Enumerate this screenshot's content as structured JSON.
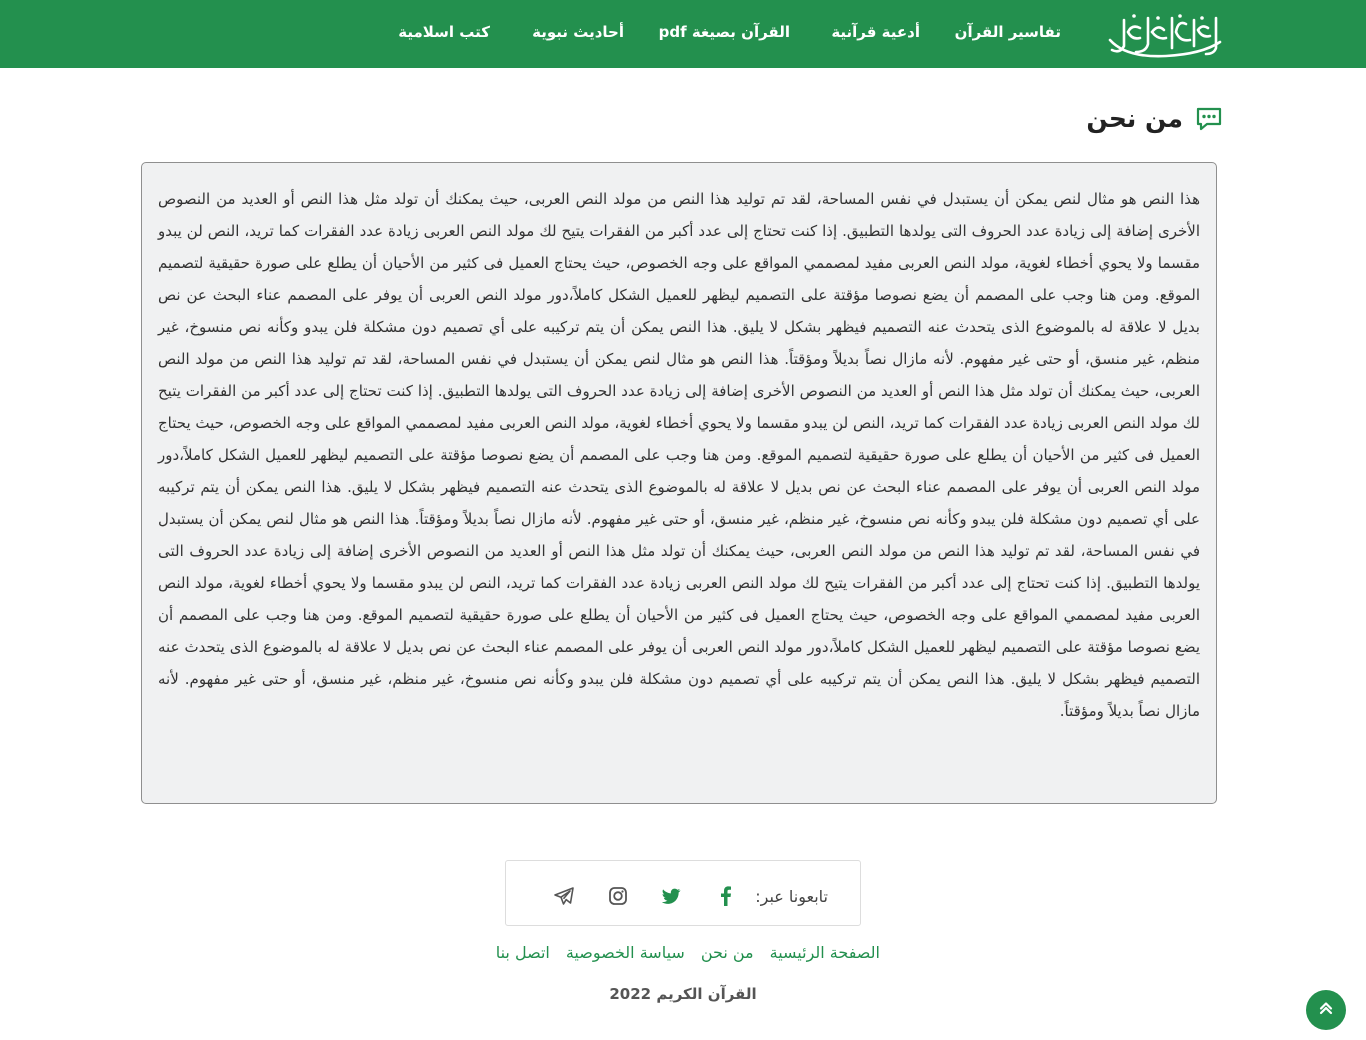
{
  "header": {
    "logo_alt": "القرآن الكريم",
    "nav": [
      {
        "label": "تفاسير القرآن"
      },
      {
        "label": "أدعية قرآنية"
      },
      {
        "label": "القرآن بصيغة pdf"
      },
      {
        "label": "أحاديث نبوية"
      },
      {
        "label": "كتب اسلامية"
      }
    ]
  },
  "page": {
    "title": "من نحن",
    "body": "هذا النص هو مثال لنص يمكن أن يستبدل في نفس المساحة، لقد تم توليد هذا النص من مولد النص العربى، حيث يمكنك أن تولد مثل هذا النص أو العديد من النصوص الأخرى إضافة إلى زيادة عدد الحروف التى يولدها التطبيق. إذا كنت تحتاج إلى عدد أكبر من الفقرات يتيح لك مولد النص العربى زيادة عدد الفقرات كما تريد، النص لن يبدو مقسما ولا يحوي أخطاء لغوية، مولد النص العربى مفيد لمصممي المواقع على وجه الخصوص، حيث يحتاج العميل فى كثير من الأحيان أن يطلع على صورة حقيقية لتصميم الموقع. ومن هنا وجب على المصمم أن يضع نصوصا مؤقتة على التصميم ليظهر للعميل الشكل كاملاً،دور مولد النص العربى أن يوفر على المصمم عناء البحث عن نص بديل لا علاقة له بالموضوع الذى يتحدث عنه التصميم فيظهر بشكل لا يليق. هذا النص يمكن أن يتم تركيبه على أي تصميم دون مشكلة فلن يبدو وكأنه نص منسوخ، غير منظم، غير منسق، أو حتى غير مفهوم. لأنه مازال نصاً بديلاً ومؤقتاً. هذا النص هو مثال لنص يمكن أن يستبدل في نفس المساحة، لقد تم توليد هذا النص من مولد النص العربى، حيث يمكنك أن تولد مثل هذا النص أو العديد من النصوص الأخرى إضافة إلى زيادة عدد الحروف التى يولدها التطبيق. إذا كنت تحتاج إلى عدد أكبر من الفقرات يتيح لك مولد النص العربى زيادة عدد الفقرات كما تريد، النص لن يبدو مقسما ولا يحوي أخطاء لغوية، مولد النص العربى مفيد لمصممي المواقع على وجه الخصوص، حيث يحتاج العميل فى كثير من الأحيان أن يطلع على صورة حقيقية لتصميم الموقع. ومن هنا وجب على المصمم أن يضع نصوصا مؤقتة على التصميم ليظهر للعميل الشكل كاملاً،دور مولد النص العربى أن يوفر على المصمم عناء البحث عن نص بديل لا علاقة له بالموضوع الذى يتحدث عنه التصميم فيظهر بشكل لا يليق. هذا النص يمكن أن يتم تركيبه على أي تصميم دون مشكلة فلن يبدو وكأنه نص منسوخ، غير منظم، غير منسق، أو حتى غير مفهوم. لأنه مازال نصاً بديلاً ومؤقتاً. هذا النص هو مثال لنص يمكن أن يستبدل في نفس المساحة، لقد تم توليد هذا النص من مولد النص العربى، حيث يمكنك أن تولد مثل هذا النص أو العديد من النصوص الأخرى إضافة إلى زيادة عدد الحروف التى يولدها التطبيق. إذا كنت تحتاج إلى عدد أكبر من الفقرات يتيح لك مولد النص العربى زيادة عدد الفقرات كما تريد، النص لن يبدو مقسما ولا يحوي أخطاء لغوية، مولد النص العربى مفيد لمصممي المواقع على وجه الخصوص، حيث يحتاج العميل فى كثير من الأحيان أن يطلع على صورة حقيقية لتصميم الموقع. ومن هنا وجب على المصمم أن يضع نصوصا مؤقتة على التصميم ليظهر للعميل الشكل كاملاً،دور مولد النص العربى أن يوفر على المصمم عناء البحث عن نص بديل لا علاقة له بالموضوع الذى يتحدث عنه التصميم فيظهر بشكل لا يليق. هذا النص يمكن أن يتم تركيبه على أي تصميم دون مشكلة فلن يبدو وكأنه نص منسوخ، غير منظم، غير منسق، أو حتى غير مفهوم. لأنه مازال نصاً بديلاً ومؤقتاً."
  },
  "footer": {
    "follow_label": "تابعونا عبر:",
    "social": [
      "facebook-icon",
      "twitter-icon",
      "instagram-icon",
      "telegram-icon"
    ],
    "links": [
      {
        "label": "الصفحة الرئيسية"
      },
      {
        "label": "من نحن"
      },
      {
        "label": "سياسة الخصوصية"
      },
      {
        "label": "اتصل بنا"
      }
    ],
    "copyright": "القرآن الكريم 2022"
  },
  "colors": {
    "brand": "#23904e",
    "content_bg": "#f0f1f2"
  }
}
